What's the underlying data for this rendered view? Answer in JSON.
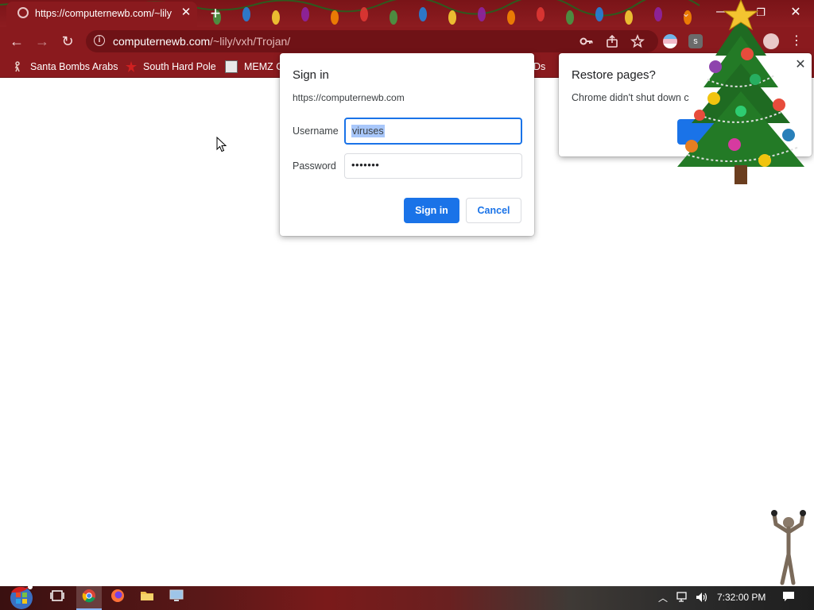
{
  "browser": {
    "tab": {
      "title": "https://computernewb.com/~lily",
      "close_icon": "close-icon"
    },
    "new_tab_label": "+",
    "window_controls": {
      "minimize": "—",
      "maximize": "❐",
      "close": "✕"
    },
    "tab_search": "⌄",
    "url": {
      "host": "computernewb.com",
      "path": "/~lily/vxh/Trojan/"
    },
    "nav": {
      "back": "←",
      "forward": "→",
      "reload": "↻"
    },
    "toolbar_icons": [
      "key-icon",
      "share-icon",
      "star-icon"
    ],
    "menu_label": "⋮"
  },
  "bookmarks": [
    {
      "label": "Santa Bombs Arabs",
      "icon": "figure-icon"
    },
    {
      "label": "South Hard Pole",
      "icon": "red-star-icon"
    },
    {
      "label": "MEMZ C",
      "icon": "memz-icon"
    }
  ],
  "bookmark_overflow_text": "Ds",
  "dialog": {
    "title": "Sign in",
    "origin": "https://computernewb.com",
    "username_label": "Username",
    "username_value": "viruses",
    "password_label": "Password",
    "password_value": "•••••••",
    "signin_label": "Sign in",
    "cancel_label": "Cancel",
    "accent": "#1a73e8"
  },
  "restore": {
    "title": "Restore pages?",
    "text": "Chrome didn't shut down c",
    "close": "✕"
  },
  "taskbar": {
    "clock": "7:32:00 PM",
    "items": [
      "task-view-icon",
      "chrome-icon",
      "firefox-icon",
      "file-explorer-icon",
      "computer-icon"
    ],
    "tray": {
      "up": "︿",
      "network": "🖧",
      "volume": "🔊",
      "notifications": "🗨"
    }
  },
  "colors": {
    "chrome_frame": "#8a1a1e",
    "page": "#ffffff"
  }
}
